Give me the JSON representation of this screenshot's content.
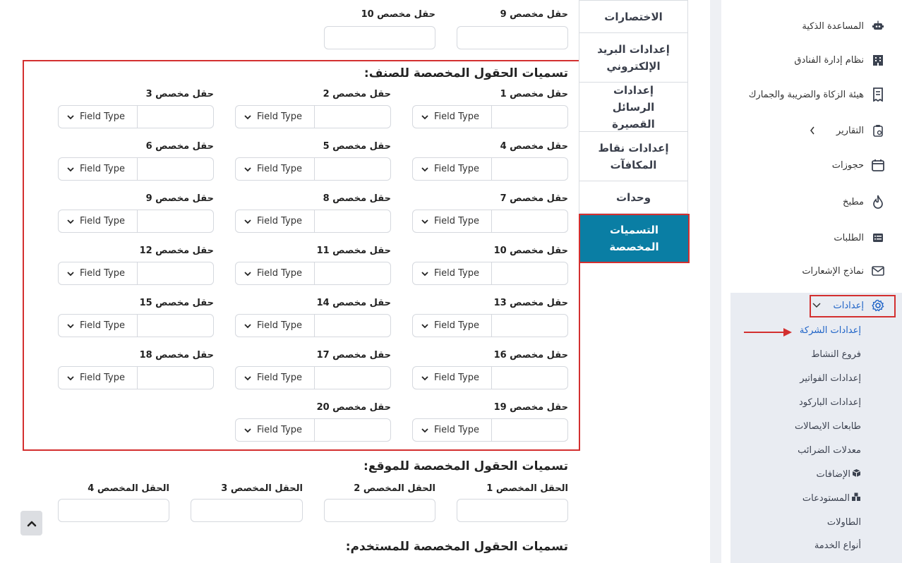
{
  "top_fields": {
    "f9": "حقل مخصص 9",
    "f10": "حقل مخصص 10"
  },
  "item_section": {
    "title": "تسميات الحقول المخصصة للصنف:",
    "field_type_label": "Field Type",
    "fields": [
      "حقل مخصص 1",
      "حقل مخصص 2",
      "حقل مخصص 3",
      "حقل مخصص 4",
      "حقل مخصص 5",
      "حقل مخصص 6",
      "حقل مخصص 7",
      "حقل مخصص 8",
      "حقل مخصص 9",
      "حقل مخصص 10",
      "حقل مخصص 11",
      "حقل مخصص 12",
      "حقل مخصص 13",
      "حقل مخصص 14",
      "حقل مخصص 15",
      "حقل مخصص 16",
      "حقل مخصص 17",
      "حقل مخصص 18",
      "حقل مخصص 19",
      "حقل مخصص 20"
    ]
  },
  "location_section": {
    "title": "تسميات الحقول المخصصة للموقع:",
    "fields": [
      "الحقل المخصص 1",
      "الحقل المخصص 2",
      "الحقل المخصص 3",
      "الحقل المخصص 4"
    ]
  },
  "user_section": {
    "title": "تسميات الحقول المخصصة للمستخدم:"
  },
  "tabs": [
    "الاختصارات",
    "إعدادات البريد الإلكتروني",
    "إعدادات الرسائل القصيرة",
    "إعدادات نقاط المكافآت",
    "وحدات",
    "التسميات المخصصة"
  ],
  "sidebar": {
    "items": [
      "المساعدة الذكية",
      "نظام إدارة الفنادق",
      "هيئة الزكاة والضريبة والجمارك",
      "التقارير",
      "حجوزات",
      "مطبخ",
      "الطلبات",
      "نماذج الإشعارات",
      "إعدادات"
    ],
    "settings_sub": [
      "إعدادات الشركة",
      "فروع النشاط",
      "إعدادات الفواتير",
      "إعدادات الباركود",
      "طابعات الايصالات",
      "معدلات الضرائب",
      "الإضافات",
      "المستودعات",
      "الطاولات",
      "أنواع الخدمة"
    ]
  },
  "colors": {
    "accent": "#0a7ea4",
    "highlight": "#d32f2f",
    "link": "#1e63c7"
  }
}
